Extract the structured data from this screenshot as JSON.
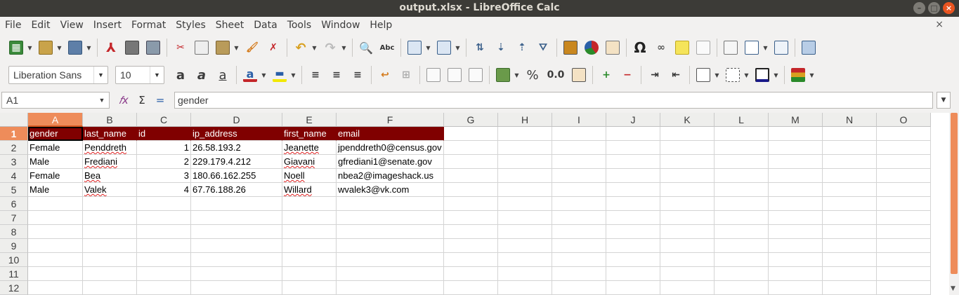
{
  "window": {
    "title": "output.xlsx - LibreOffice Calc",
    "controls": [
      "–",
      "□",
      "×"
    ]
  },
  "menubar": {
    "items": [
      "File",
      "Edit",
      "View",
      "Insert",
      "Format",
      "Styles",
      "Sheet",
      "Data",
      "Tools",
      "Window",
      "Help"
    ],
    "close_doc": "×"
  },
  "toolbar2": {
    "font_name": "Liberation Sans",
    "font_size": "10",
    "percent_label": "%",
    "number_label": "0.0"
  },
  "formula_bar": {
    "name_box": "A1",
    "content": "gender"
  },
  "grid": {
    "columns": [
      "A",
      "B",
      "C",
      "D",
      "E",
      "F",
      "G",
      "H",
      "I",
      "J",
      "K",
      "L",
      "M",
      "N",
      "O"
    ],
    "row_numbers": [
      "1",
      "2",
      "3",
      "4",
      "5",
      "6",
      "7",
      "8",
      "9",
      "10",
      "11",
      "12"
    ],
    "rows": [
      [
        "gender",
        "last_name",
        "id",
        "ip_address",
        "first_name",
        "email"
      ],
      [
        "Female",
        "Penddreth",
        "1",
        "26.58.193.2",
        "Jeanette",
        "jpenddreth0@census.gov"
      ],
      [
        "Male",
        "Frediani",
        "2",
        "229.179.4.212",
        "Giavani",
        "gfrediani1@senate.gov"
      ],
      [
        "Female",
        "Bea",
        "3",
        "180.66.162.255",
        "Noell",
        "nbea2@imageshack.us"
      ],
      [
        "Male",
        "Valek",
        "4",
        "67.76.188.26",
        "Willard",
        "wvalek3@vk.com"
      ]
    ],
    "active_cell": "A1",
    "header_color": "#800000",
    "accent_color": "#ee8c5a"
  }
}
